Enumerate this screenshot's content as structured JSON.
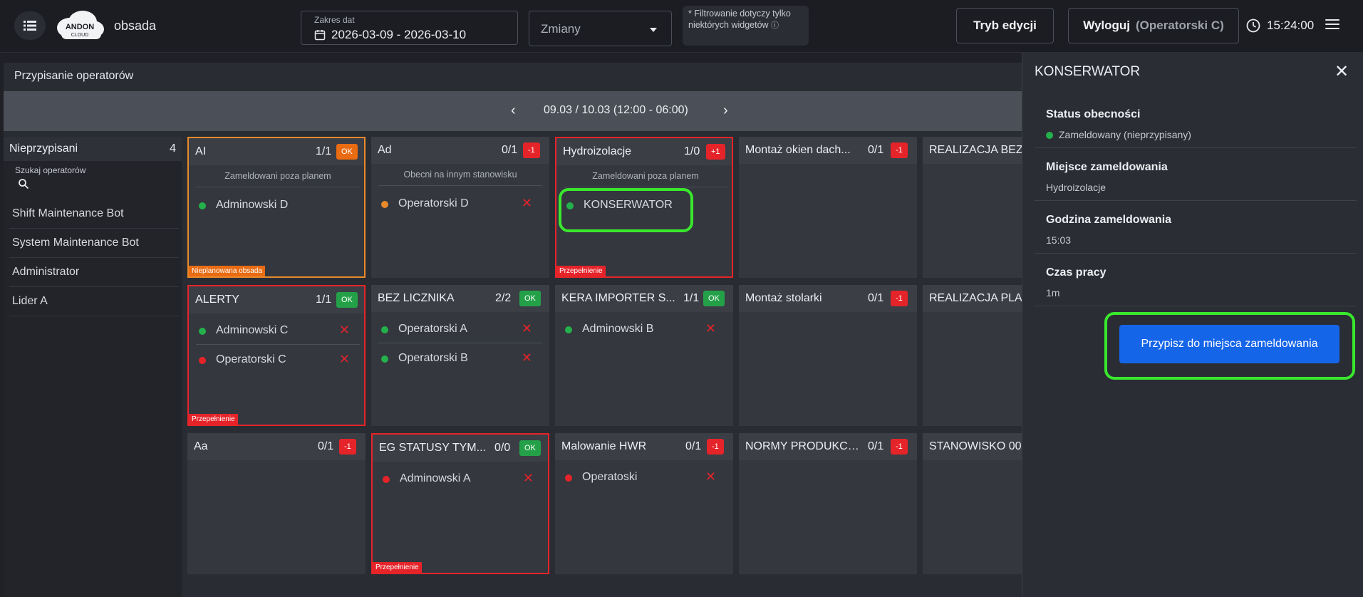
{
  "header": {
    "app_name": "obsada",
    "logo_text": "ANDON CLOUD",
    "date_range": {
      "label": "Zakres dat",
      "value": "2026-03-09 - 2026-03-10"
    },
    "shift_select": {
      "value": "Zmiany"
    },
    "filter_note": "* Filtrowanie dotyczy tylko niektórych widgetów",
    "edit_button": "Tryb edycji",
    "logout_button": "Wyloguj",
    "logout_user": "(Operatorski C)",
    "time": "15:24:00"
  },
  "panel": {
    "title": "Przypisanie operatorów",
    "period": "09.03 / 10.03 (12:00 - 06:00)",
    "prev": "‹",
    "next": "›"
  },
  "unassigned": {
    "title": "Nieprzypisani",
    "count": "4",
    "search_label": "Szukaj operatorów",
    "items": [
      "Shift Maintenance Bot",
      "System Maintenance Bot",
      "Administrator",
      "Lider A"
    ]
  },
  "stations": [
    {
      "title": "AI",
      "count": "1/1",
      "badge": "OK",
      "badge_type": "warn",
      "subtitle": "Zameldowani poza planem",
      "tag": "Nieplanowana obsada",
      "operators": [
        {
          "name": "Adminowski D",
          "status": "green",
          "removable": false
        }
      ]
    },
    {
      "title": "Ad",
      "count": "0/1",
      "badge": "-1",
      "badge_type": "err",
      "subtitle": "Obecni na innym stanowisku",
      "tag": "",
      "operators": [
        {
          "name": "Operatorski D",
          "status": "orange",
          "removable": true
        }
      ]
    },
    {
      "title": "Hydroizolacje",
      "count": "1/0",
      "badge": "+1",
      "badge_type": "err",
      "subtitle": "Zameldowani poza planem",
      "tag": "Przepełnienie",
      "operators": [
        {
          "name": "KONSERWATOR",
          "status": "green",
          "removable": false
        }
      ]
    },
    {
      "title": "Montaż okien dach...",
      "count": "0/1",
      "badge": "-1",
      "badge_type": "err"
    },
    {
      "title": "REALIZACJA BEZ",
      "count": "",
      "badge": ""
    },
    {
      "title": "ALERTY",
      "count": "1/1",
      "badge": "OK",
      "badge_type": "ok",
      "tag": "Przepełnienie",
      "operators": [
        {
          "name": "Adminowski C",
          "status": "green",
          "removable": true
        },
        {
          "name": "Operatorski C",
          "status": "red",
          "removable": true
        }
      ]
    },
    {
      "title": "BEZ LICZNIKA",
      "count": "2/2",
      "badge": "OK",
      "badge_type": "ok",
      "operators": [
        {
          "name": "Operatorski A",
          "status": "green",
          "removable": true
        },
        {
          "name": "Operatorski B",
          "status": "green",
          "removable": true
        }
      ]
    },
    {
      "title": "KERA IMPORTER S...",
      "count": "1/1",
      "badge": "OK",
      "badge_type": "ok",
      "operators": [
        {
          "name": "Adminowski B",
          "status": "green",
          "removable": true
        }
      ]
    },
    {
      "title": "Montaż stolarki",
      "count": "0/1",
      "badge": "-1",
      "badge_type": "err"
    },
    {
      "title": "REALIZACJA PLA",
      "count": "",
      "badge": ""
    },
    {
      "title": "Aa",
      "count": "0/1",
      "badge": "-1",
      "badge_type": "err"
    },
    {
      "title": "EG STATUSY TYM...",
      "count": "0/0",
      "badge": "OK",
      "badge_type": "ok",
      "tag": "Przepełnienie",
      "operators": [
        {
          "name": "Adminowski A",
          "status": "red",
          "removable": true
        }
      ]
    },
    {
      "title": "Malowanie HWR",
      "count": "0/1",
      "badge": "-1",
      "badge_type": "err",
      "operators": [
        {
          "name": "Operatoski",
          "status": "red",
          "removable": true
        }
      ]
    },
    {
      "title": "NORMY PRODUKCY...",
      "count": "0/1",
      "badge": "-1",
      "badge_type": "err"
    },
    {
      "title": "STANOWISKO 00",
      "count": "",
      "badge": ""
    }
  ],
  "drawer": {
    "title": "KONSERWATOR",
    "close": "✕",
    "fields": [
      {
        "label": "Status obecności",
        "value": "Zameldowany (nieprzypisany)"
      },
      {
        "label": "Miejsce zameldowania",
        "value": "Hydroizolacje"
      },
      {
        "label": "Godzina zameldowania",
        "value": "15:03"
      },
      {
        "label": "Czas pracy",
        "value": "1m"
      }
    ],
    "assign_button": "Przypisz do miejsca zameldowania"
  },
  "colors": {
    "ok": "#24a148",
    "warn": "#e96b12",
    "err": "#e5242a",
    "highlight": "#39e82d",
    "primary_button": "#1565e8",
    "status_green": "#24b14c",
    "status_orange": "#e98a2a",
    "status_red": "#e5242a"
  }
}
